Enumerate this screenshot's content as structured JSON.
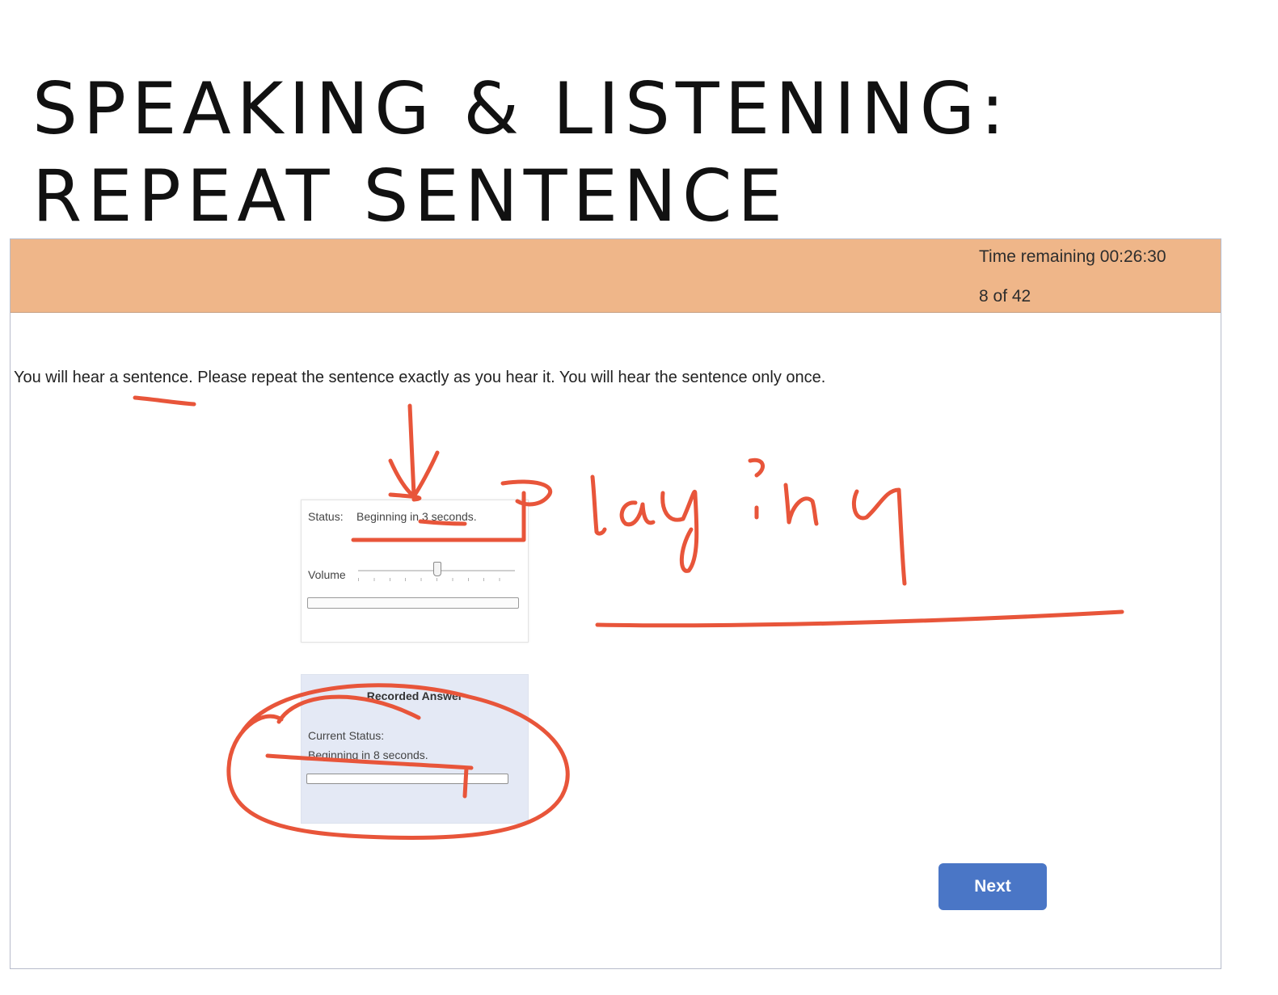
{
  "slide": {
    "title_line1": "SPEAKING & LISTENING:",
    "title_line2": "REPEAT SENTENCE"
  },
  "header": {
    "time_remaining": "Time remaining 00:26:30",
    "progress": "8 of 42",
    "background_color": "#efb689"
  },
  "instruction": "You will hear a sentence. Please repeat the sentence exactly as you hear it. You will hear the sentence only once.",
  "audio_player": {
    "status_label": "Status:",
    "status_value": "Beginning in 3 seconds.",
    "volume_label": "Volume",
    "volume_level": 0.5,
    "playback_progress": 0
  },
  "recorder": {
    "title": "Recorded Answer",
    "current_status_label": "Current Status:",
    "current_status_value": "Beginning in 8 seconds.",
    "recording_progress": 0
  },
  "next_button": {
    "label": "Next",
    "color": "#4a76c6"
  },
  "annotation": {
    "handwritten_text": "Playing",
    "ink_color": "#e8553a"
  }
}
